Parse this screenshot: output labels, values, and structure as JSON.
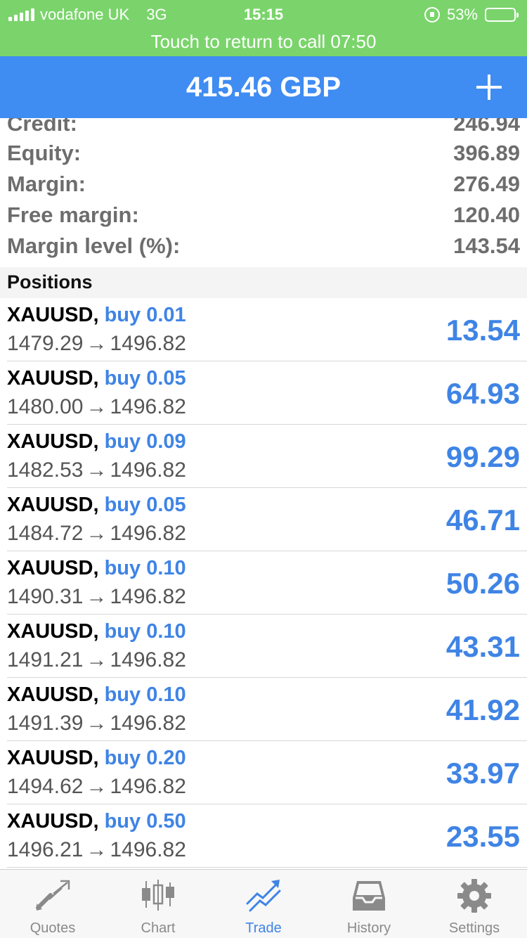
{
  "status_bar": {
    "carrier": "vodafone UK",
    "network": "3G",
    "time": "15:15",
    "battery": "53%"
  },
  "call_bar": {
    "text": "Touch to return to call 07:50"
  },
  "header": {
    "title": "415.46 GBP"
  },
  "summary": {
    "credit_label": "Credit:",
    "credit_value": "246.94",
    "equity_label": "Equity:",
    "equity_value": "396.89",
    "margin_label": "Margin:",
    "margin_value": "276.49",
    "free_margin_label": "Free margin:",
    "free_margin_value": "120.40",
    "margin_level_label": "Margin level (%):",
    "margin_level_value": "143.54"
  },
  "positions_title": "Positions",
  "positions": [
    {
      "symbol": "XAUUSD,",
      "type": "buy 0.01",
      "open": "1479.29",
      "arrow": "→",
      "current": "1496.82",
      "profit": "13.54"
    },
    {
      "symbol": "XAUUSD,",
      "type": "buy 0.05",
      "open": "1480.00",
      "arrow": "→",
      "current": "1496.82",
      "profit": "64.93"
    },
    {
      "symbol": "XAUUSD,",
      "type": "buy 0.09",
      "open": "1482.53",
      "arrow": "→",
      "current": "1496.82",
      "profit": "99.29"
    },
    {
      "symbol": "XAUUSD,",
      "type": "buy 0.05",
      "open": "1484.72",
      "arrow": "→",
      "current": "1496.82",
      "profit": "46.71"
    },
    {
      "symbol": "XAUUSD,",
      "type": "buy 0.10",
      "open": "1490.31",
      "arrow": "→",
      "current": "1496.82",
      "profit": "50.26"
    },
    {
      "symbol": "XAUUSD,",
      "type": "buy 0.10",
      "open": "1491.21",
      "arrow": "→",
      "current": "1496.82",
      "profit": "43.31"
    },
    {
      "symbol": "XAUUSD,",
      "type": "buy 0.10",
      "open": "1491.39",
      "arrow": "→",
      "current": "1496.82",
      "profit": "41.92"
    },
    {
      "symbol": "XAUUSD,",
      "type": "buy 0.20",
      "open": "1494.62",
      "arrow": "→",
      "current": "1496.82",
      "profit": "33.97"
    },
    {
      "symbol": "XAUUSD,",
      "type": "buy 0.50",
      "open": "1496.21",
      "arrow": "→",
      "current": "1496.82",
      "profit": "23.55"
    }
  ],
  "tabs": {
    "quotes": "Quotes",
    "chart": "Chart",
    "trade": "Trade",
    "history": "History",
    "settings": "Settings"
  },
  "colors": {
    "status_green": "#7ad46b",
    "header_blue": "#3f8cf2",
    "accent_blue": "#3f84e5"
  },
  "icons": [
    "signal-icon",
    "lock-rotation-icon",
    "battery-icon",
    "plus-icon",
    "quotes-icon",
    "chart-icon",
    "trade-icon",
    "history-icon",
    "settings-icon"
  ]
}
